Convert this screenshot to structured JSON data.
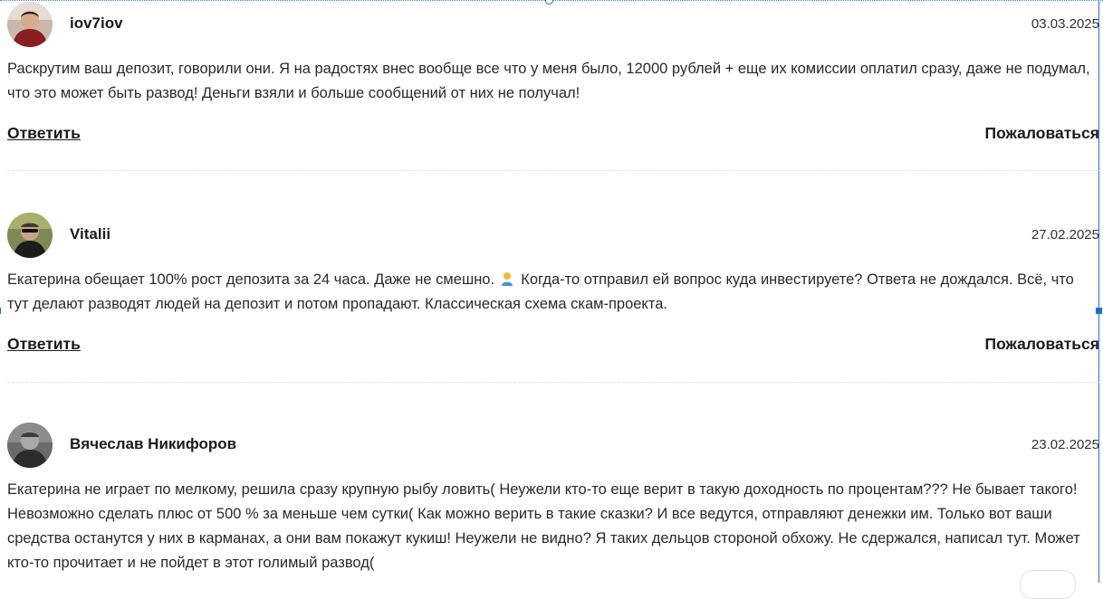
{
  "comments": [
    {
      "username": "iov7iov",
      "date": "03.03.2025",
      "text": "Раскрутим ваш депозит, говорили они. Я на радостях внес вообще все что у меня было, 12000 рублей + еще их комиссии оплатил сразу, даже не подумал, что это может быть развод! Деньги взяли и больше сообщений от них не получал!",
      "reply_label": "Ответить",
      "complain_label": "Пожаловаться"
    },
    {
      "username": "Vitalii",
      "date": "27.02.2025",
      "text_before_emoji": "Екатерина обещает 100% рост депозита за 24 часа. Даже не смешно.",
      "emoji": "person-icon",
      "text_after_emoji": "Когда-то отправил ей вопрос куда инвестируете? Ответа не дождался. Всё, что тут делают разводят людей на депозит и потом пропадают. Классическая схема скам-проекта.",
      "reply_label": "Ответить",
      "complain_label": "Пожаловаться"
    },
    {
      "username": "Вячеслав Никифоров",
      "date": "23.02.2025",
      "text": "Екатерина не играет по мелкому, решила сразу крупную рыбу ловить( Неужели кто-то еще верит в такую доходность по процентам??? Не бывает такого! Невозможно сделать плюс от 500 % за меньше чем сутки( Как можно верить в такие сказки? И все ведутся, отправляют денежки им. Только вот ваши средства останутся у них в карманах, а они вам покажут кукиш! Неужели не видно? Я таких дельцов стороной обхожу. Не сдержался, написал тут. Может кто-то прочитает и не пойдет в этот голимый развод("
    }
  ],
  "colors": {
    "text": "#222222",
    "separator": "#e3e3e3",
    "selection": "#1f6fd6"
  }
}
